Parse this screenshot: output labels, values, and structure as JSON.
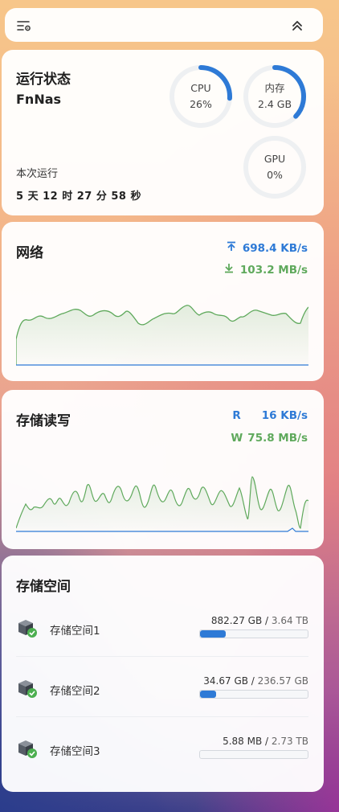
{
  "topbar": {
    "settings_icon": "filter-settings-icon",
    "collapse_icon": "double-chevron-up-icon"
  },
  "status": {
    "title": "运行状态",
    "host": "FnNas",
    "uptime_label": "本次运行",
    "uptime_value": "5 天 12 时 27 分 58 秒",
    "cpu": {
      "label": "CPU",
      "value": "26%",
      "fraction": 0.26
    },
    "mem": {
      "label": "内存",
      "value": "2.4 GB",
      "fraction": 0.37
    },
    "gpu": {
      "label": "GPU",
      "value": "0%",
      "fraction": 0
    }
  },
  "network": {
    "title": "网络",
    "up": "698.4 KB/s",
    "down": "103.2 MB/s"
  },
  "storage_io": {
    "title": "存储读写",
    "read_label": "R",
    "read": "16 KB/s",
    "write_label": "W",
    "write": "75.8 MB/s"
  },
  "storage_space": {
    "title": "存储空间",
    "items": [
      {
        "name": "存储空间1",
        "used": "882.27 GB",
        "total": "3.64 TB",
        "fraction": 0.24
      },
      {
        "name": "存储空间2",
        "used": "34.67 GB",
        "total": "236.57 GB",
        "fraction": 0.15
      },
      {
        "name": "存储空间3",
        "used": "5.88 MB",
        "total": "2.73 TB",
        "fraction": 0.0
      }
    ]
  },
  "colors": {
    "accent_blue": "#2e7ad6",
    "accent_green": "#5fa95c",
    "ring_track": "#eef0f2"
  }
}
